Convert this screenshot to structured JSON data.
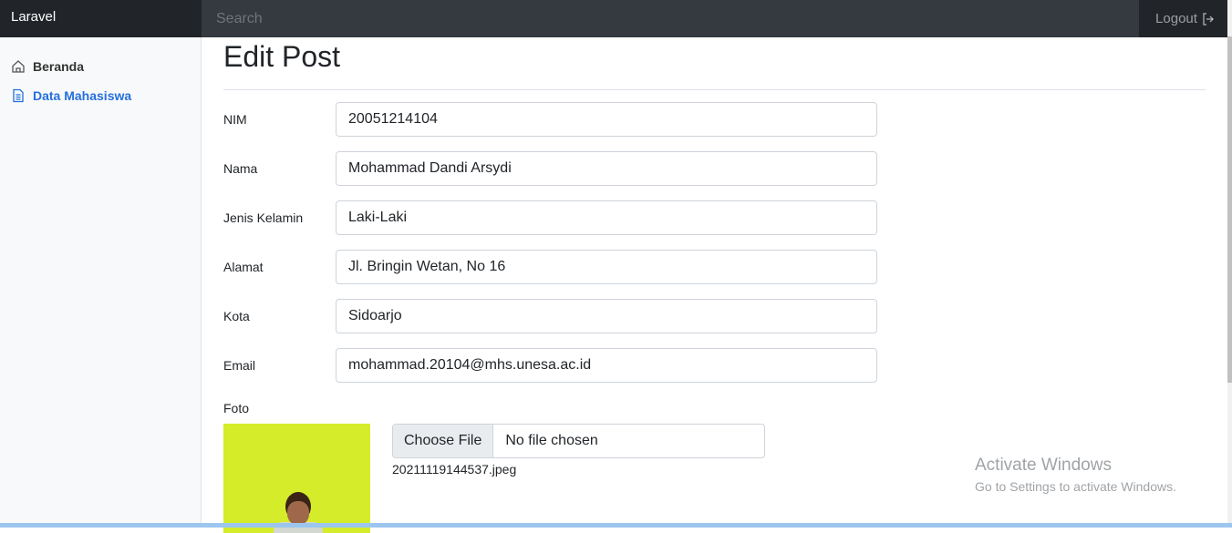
{
  "navbar": {
    "brand": "Laravel",
    "search_placeholder": "Search",
    "logout_label": "Logout"
  },
  "sidebar": {
    "items": [
      {
        "label": "Beranda",
        "icon": "home-icon",
        "active": false
      },
      {
        "label": "Data Mahasiswa",
        "icon": "file-icon",
        "active": true
      }
    ]
  },
  "main": {
    "title": "Edit Post",
    "fields": [
      {
        "label": "NIM",
        "value": "20051214104"
      },
      {
        "label": "Nama",
        "value": "Mohammad Dandi Arsydi"
      },
      {
        "label": "Jenis Kelamin",
        "value": "Laki-Laki"
      },
      {
        "label": "Alamat",
        "value": "Jl. Bringin Wetan, No 16"
      },
      {
        "label": "Kota",
        "value": "Sidoarjo"
      },
      {
        "label": "Email",
        "value": "mohammad.20104@mhs.unesa.ac.id"
      }
    ],
    "foto": {
      "label": "Foto",
      "choose_button": "Choose File",
      "status": "No file chosen",
      "current_file": "20211119144537.jpeg"
    }
  },
  "watermark": {
    "title": "Activate Windows",
    "subtitle": "Go to Settings to activate Windows."
  },
  "colors": {
    "navbar_bg": "#343a40",
    "brand_bg": "#212529",
    "active_link": "#2470dc"
  }
}
